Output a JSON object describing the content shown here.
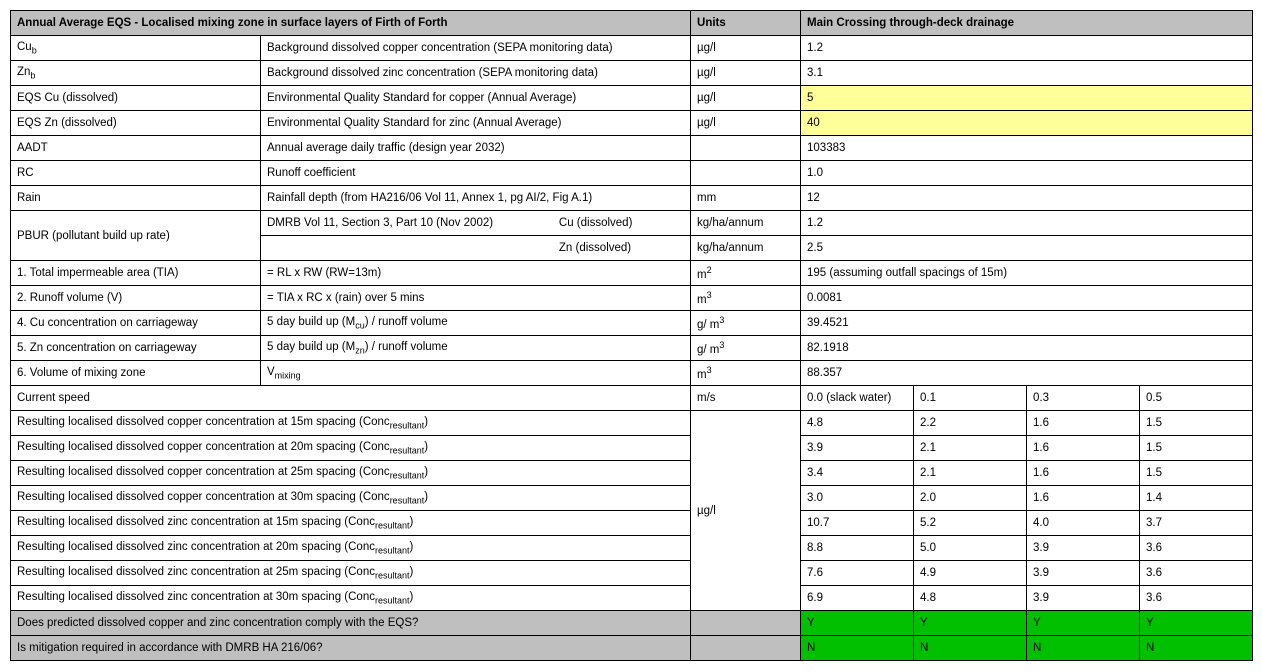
{
  "header": {
    "title": "Annual Average EQS - Localised mixing zone in surface layers of Firth of Forth",
    "units": "Units",
    "main": "Main Crossing  through-deck drainage"
  },
  "rows": {
    "cub": {
      "param": "Cu",
      "desc": "Background dissolved copper concentration (SEPA monitoring data)",
      "unit": "µg/l",
      "val": "1.2"
    },
    "znb": {
      "param": "Zn",
      "desc": "Background dissolved zinc concentration (SEPA monitoring data)",
      "unit": "µg/l",
      "val": "3.1"
    },
    "eqscu": {
      "param": "EQS Cu (dissolved)",
      "desc": "Environmental Quality Standard for copper (Annual Average)",
      "unit": "µg/l",
      "val": "5"
    },
    "eqszn": {
      "param": "EQS Zn (dissolved)",
      "desc": "Environmental Quality Standard for zinc (Annual Average)",
      "unit": "µg/l",
      "val": "40"
    },
    "aadt": {
      "param": "AADT",
      "desc": "Annual average daily traffic (design year 2032)",
      "unit": "",
      "val": "103383"
    },
    "rc": {
      "param": "RC",
      "desc": "Runoff coefficient",
      "unit": "",
      "val": "1.0"
    },
    "rain": {
      "param": "Rain",
      "desc": "Rainfall depth (from HA216/06 Vol 11, Annex 1, pg AI/2, Fig A.1)",
      "unit": "mm",
      "val": "12"
    },
    "pbur": {
      "param": "PBUR  (pollutant build up rate)",
      "desc1a": "DMRB Vol 11, Section 3, Part 10 (Nov 2002)",
      "desc1b": "Cu (dissolved)",
      "unit1": "kg/ha/annum",
      "val1": "1.2",
      "desc2": "Zn (dissolved)",
      "unit2": "kg/ha/annum",
      "val2": "2.5"
    },
    "tia": {
      "param": "1. Total impermeable area (TIA)",
      "desc": "= RL x RW (RW=13m)",
      "unit": "m",
      "val": "195 (assuming outfall spacings of 15m)"
    },
    "v": {
      "param": "2. Runoff volume (V)",
      "desc": "= TIA x RC x (rain) over 5 mins",
      "unit": "m",
      "val": "0.0081"
    },
    "cu": {
      "param": "4. Cu concentration on carriageway",
      "desc": " 5 day build up (M",
      "desc2": ") / runoff volume",
      "unit": "g/ m",
      "val": "39.4521"
    },
    "zn": {
      "param": "5. Zn concentration on carriageway",
      "desc": " 5 day build up (M",
      "desc2": ") / runoff volume",
      "unit": "g/ m",
      "val": "82.1918"
    },
    "vmix": {
      "param": "6. Volume of mixing zone",
      "desc": "V",
      "unit": "m",
      "val": "88.357"
    },
    "speed": {
      "param": "Current speed",
      "unit": "m/s",
      "v0": "0.0 (slack water)",
      "v1": "0.1",
      "v2": "0.3",
      "v3": "0.5"
    },
    "resUnit": "µg/l",
    "cu15": {
      "label": "Resulting localised dissolved copper concentration at 15m spacing (Conc",
      "v0": "4.8",
      "v1": "2.2",
      "v2": "1.6",
      "v3": "1.5"
    },
    "cu20": {
      "label": "Resulting localised dissolved copper concentration at 20m spacing (Conc",
      "v0": "3.9",
      "v1": "2.1",
      "v2": "1.6",
      "v3": "1.5"
    },
    "cu25": {
      "label": "Resulting localised dissolved copper concentration at 25m spacing (Conc",
      "v0": "3.4",
      "v1": "2.1",
      "v2": "1.6",
      "v3": "1.5"
    },
    "cu30": {
      "label": "Resulting localised dissolved copper concentration at 30m spacing (Conc",
      "v0": "3.0",
      "v1": "2.0",
      "v2": "1.6",
      "v3": "1.4"
    },
    "zn15": {
      "label": "Resulting localised dissolved zinc concentration at 15m spacing (Conc",
      "v0": "10.7",
      "v1": "5.2",
      "v2": "4.0",
      "v3": "3.7"
    },
    "zn20": {
      "label": "Resulting localised dissolved zinc concentration at 20m spacing (Conc",
      "v0": "8.8",
      "v1": "5.0",
      "v2": "3.9",
      "v3": "3.6"
    },
    "zn25": {
      "label": "Resulting localised dissolved zinc concentration at 25m spacing (Conc",
      "v0": "7.6",
      "v1": "4.9",
      "v2": "3.9",
      "v3": "3.6"
    },
    "zn30": {
      "label": "Resulting localised dissolved zinc concentration at 30m spacing (Conc",
      "v0": "6.9",
      "v1": "4.8",
      "v2": "3.9",
      "v3": "3.6"
    },
    "comply": {
      "label": "Does predicted dissolved copper and zinc concentration comply with the EQS?",
      "v0": "Y",
      "v1": "Y",
      "v2": "Y",
      "v3": "Y"
    },
    "mitig": {
      "label": "Is mitigation required in accordance with DMRB HA 216/06?",
      "v0": "N",
      "v1": "N",
      "v2": "N",
      "v3": "N"
    },
    "resSuffix": ")"
  }
}
